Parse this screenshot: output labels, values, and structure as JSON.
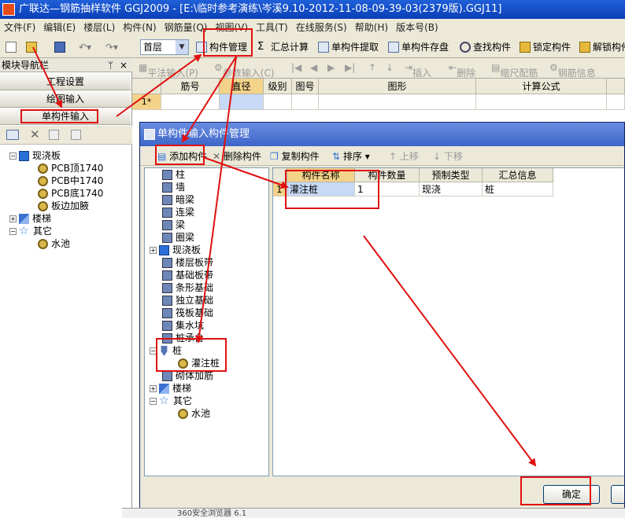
{
  "window": {
    "title": "广联达—钢筋抽样软件 GGJ2009 - [E:\\临时参考演练\\岑溪9.10-2012-11-08-09-39-03(2379版).GGJ11]"
  },
  "menu": [
    "文件(F)",
    "编辑(E)",
    "楼层(L)",
    "构件(N)",
    "钢筋量(Q)",
    "视图(V)",
    "工具(T)",
    "在线服务(S)",
    "帮助(H)",
    "版本号(B)"
  ],
  "toolbar": {
    "floor": "首层",
    "buttons": [
      "构件管理",
      "汇总计算",
      "单构件提取",
      "单构件存盘",
      "查找构件",
      "锁定构件",
      "解锁构件"
    ]
  },
  "nav": {
    "title": "模块导航栏",
    "pin": "ᛘ",
    "close": "×",
    "buttons": [
      "工程设置",
      "绘图输入",
      "单构件输入"
    ],
    "tree": {
      "slab": "现浇板",
      "slab_children": [
        "PCB顶1740",
        "PCB中1740",
        "PCB底1740",
        "板边加腋"
      ],
      "stairs": "楼梯",
      "other": "其它",
      "pool": "水池"
    }
  },
  "editor": {
    "toolbar": [
      "平法输入(P)",
      "参数输入(C)",
      "插入",
      "删除",
      "缩尺配筋",
      "钢筋信息"
    ],
    "columns": [
      "筋号",
      "直径(mm)",
      "级别",
      "图号",
      "图形",
      "计算公式"
    ],
    "row_label": "1*"
  },
  "dialog": {
    "title": "单构件输入构件管理",
    "toolbar": [
      "添加构件",
      "删除构件",
      "复制构件",
      "排序",
      "上移",
      "下移"
    ],
    "tree": [
      "柱",
      "墙",
      "暗梁",
      "连梁",
      "梁",
      "圈梁",
      "现浇板",
      "楼层板带",
      "基础板带",
      "条形基础",
      "独立基础",
      "筏板基础",
      "集水坑",
      "桩承台",
      "桩",
      "灌注桩",
      "砌体加筋",
      "楼梯",
      "其它",
      "水池"
    ],
    "table": {
      "columns": [
        "构件名称",
        "构件数量",
        "预制类型",
        "汇总信息"
      ],
      "rows": [
        {
          "index": "1",
          "name": "灌注桩",
          "count": "1",
          "type": "现浇",
          "summary": "桩"
        }
      ]
    },
    "ok": "确定"
  },
  "taskbar": {
    "text": "360安全浏览器 6.1"
  },
  "colors": {
    "annotation": "#e01010",
    "titlebar": "#0a3fb8",
    "dialog_title": "#3d66c9"
  }
}
